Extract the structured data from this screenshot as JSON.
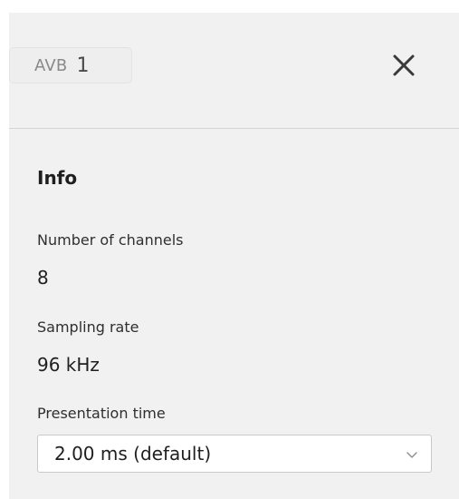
{
  "header": {
    "tag_prefix": "AVB",
    "tag_number": "1",
    "close_icon": "close-icon"
  },
  "info": {
    "title": "Info",
    "channels_label": "Number of channels",
    "channels_value": "8",
    "sampling_label": "Sampling rate",
    "sampling_value": "96 kHz",
    "presentation_label": "Presentation time",
    "presentation_selected": "2.00 ms (default)",
    "chevron_icon": "chevron-down-icon"
  },
  "colors": {
    "panel_bg": "#f1f1f1",
    "divider": "#d3d3d3",
    "tag_text": "#8a8a8a"
  }
}
